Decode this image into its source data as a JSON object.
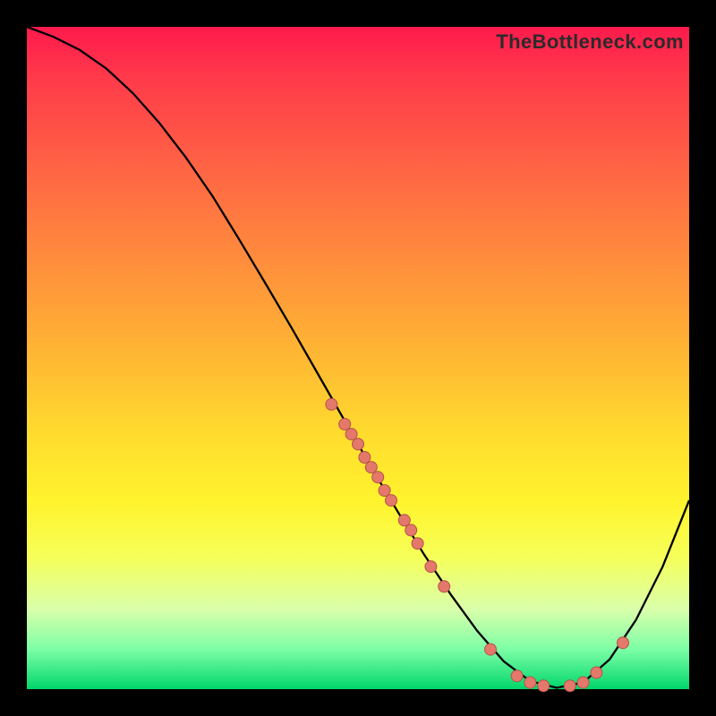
{
  "watermark": "TheBottleneck.com",
  "chart_data": {
    "type": "line",
    "title": "",
    "xlabel": "",
    "ylabel": "",
    "xlim": [
      0,
      100
    ],
    "ylim": [
      0,
      100
    ],
    "curve": {
      "x": [
        0,
        4,
        8,
        12,
        16,
        20,
        24,
        28,
        32,
        36,
        40,
        44,
        48,
        52,
        56,
        60,
        64,
        68,
        72,
        76,
        80,
        84,
        88,
        92,
        96,
        100
      ],
      "y": [
        100,
        98.5,
        96.5,
        93.7,
        90.0,
        85.5,
        80.3,
        74.5,
        68.0,
        61.3,
        54.5,
        47.5,
        40.5,
        33.5,
        26.8,
        20.3,
        14.3,
        8.8,
        4.2,
        1.2,
        0.2,
        1.0,
        4.5,
        10.5,
        18.5,
        28.5
      ]
    },
    "points": [
      {
        "x": 46,
        "y": 43
      },
      {
        "x": 48,
        "y": 40
      },
      {
        "x": 49,
        "y": 38.5
      },
      {
        "x": 50,
        "y": 37
      },
      {
        "x": 51,
        "y": 35
      },
      {
        "x": 52,
        "y": 33.5
      },
      {
        "x": 53,
        "y": 32
      },
      {
        "x": 54,
        "y": 30
      },
      {
        "x": 55,
        "y": 28.5
      },
      {
        "x": 57,
        "y": 25.5
      },
      {
        "x": 58,
        "y": 24
      },
      {
        "x": 59,
        "y": 22
      },
      {
        "x": 61,
        "y": 18.5
      },
      {
        "x": 63,
        "y": 15.5
      },
      {
        "x": 70,
        "y": 6
      },
      {
        "x": 74,
        "y": 2
      },
      {
        "x": 76,
        "y": 1
      },
      {
        "x": 78,
        "y": 0.5
      },
      {
        "x": 82,
        "y": 0.5
      },
      {
        "x": 84,
        "y": 1
      },
      {
        "x": 86,
        "y": 2.5
      },
      {
        "x": 90,
        "y": 7
      }
    ]
  }
}
